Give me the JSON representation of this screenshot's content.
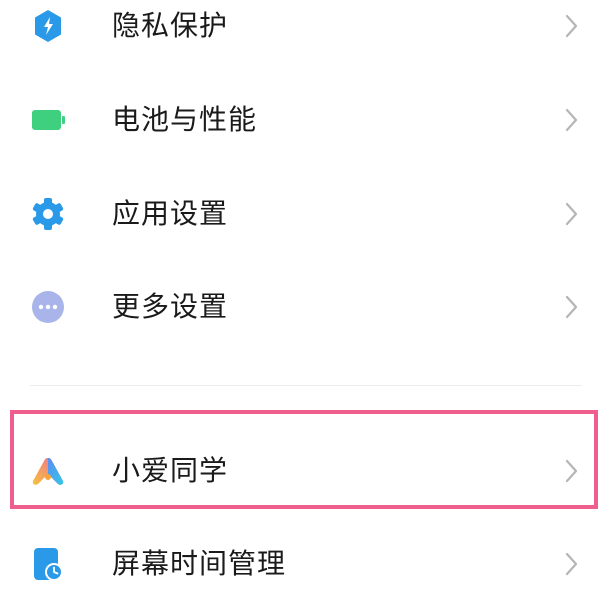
{
  "settings": {
    "items": [
      {
        "label": "隐私保护",
        "icon": "privacy-shield-icon"
      },
      {
        "label": "电池与性能",
        "icon": "battery-icon"
      },
      {
        "label": "应用设置",
        "icon": "app-gear-icon"
      },
      {
        "label": "更多设置",
        "icon": "more-dots-icon"
      },
      {
        "label": "小爱同学",
        "icon": "xiaoai-logo-icon"
      },
      {
        "label": "屏幕时间管理",
        "icon": "screen-time-clock-icon"
      }
    ]
  },
  "highlight": {
    "target": "小爱同学",
    "color": "#f05e8d"
  },
  "colors": {
    "privacy": "#2a9ae8",
    "battery": "#3ed07e",
    "gear": "#2a9ae8",
    "more": "#a9b5ea",
    "chevron": "#b5b5b5",
    "text": "#1a1a1a"
  }
}
